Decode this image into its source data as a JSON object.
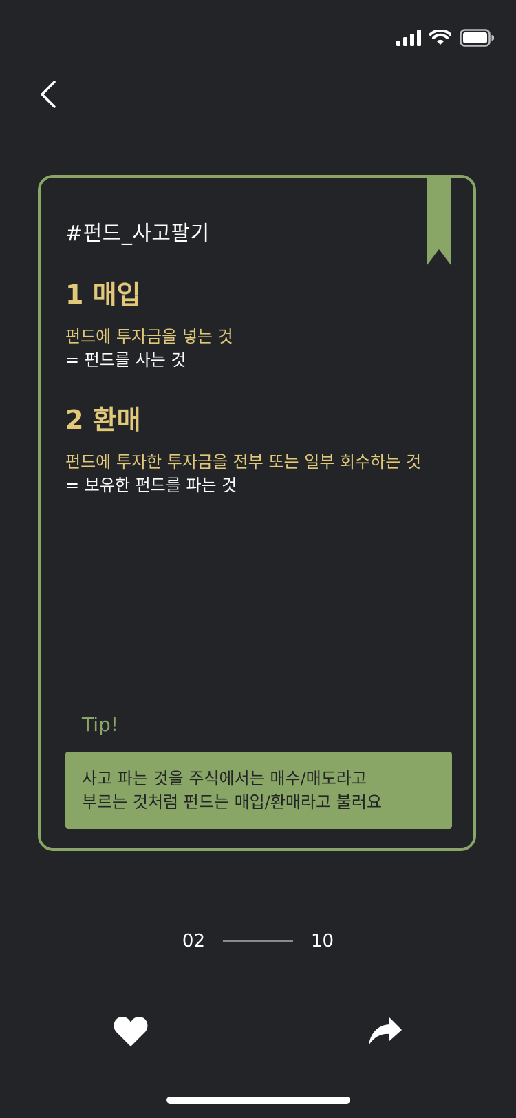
{
  "status_bar": {
    "signal_icon": "signal-bars-icon",
    "wifi_icon": "wifi-icon",
    "battery_icon": "battery-icon"
  },
  "nav": {
    "back_icon": "chevron-left-icon"
  },
  "card": {
    "hashtag": "#펀드_사고팔기",
    "bookmark_icon": "bookmark-ribbon-icon",
    "sections": [
      {
        "title": "1 매입",
        "description": "펀드에 투자금을 넣는 것",
        "equivalent": "= 펀드를 사는 것"
      },
      {
        "title": "2 환매",
        "description": "펀드에 투자한 투자금을 전부 또는 일부 회수하는 것",
        "equivalent": "= 보유한 펀드를 파는 것"
      }
    ],
    "tip_label": "Tip!",
    "tip_lines": [
      "사고 파는 것을 주식에서는 매수/매도라고",
      "부르는 것처럼 펀드는 매입/환매라고 불러요"
    ]
  },
  "pager": {
    "current": "02",
    "total": "10",
    "progress": 0.2
  },
  "actions": {
    "like_icon": "heart-icon",
    "share_icon": "share-arrow-icon"
  },
  "colors": {
    "background": "#232428",
    "accent_green": "#89a667",
    "accent_gold": "#e1c979",
    "text_white": "#ffffff"
  }
}
